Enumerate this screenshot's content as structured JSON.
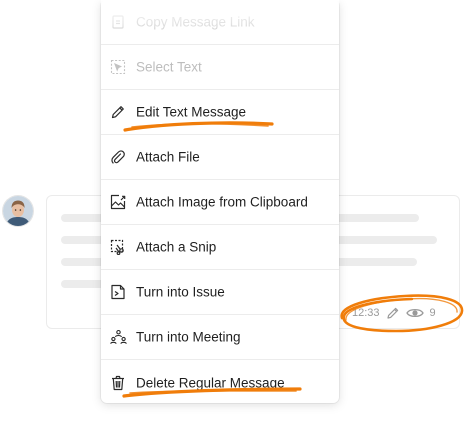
{
  "menu": {
    "items": [
      {
        "label": "Copy Message Link",
        "icon": "link-copy-icon",
        "disabled": true
      },
      {
        "label": "Select Text",
        "icon": "select-text-icon",
        "disabled": true
      },
      {
        "label": "Edit Text Message",
        "icon": "pencil-icon",
        "disabled": false
      },
      {
        "label": "Attach File",
        "icon": "paperclip-icon",
        "disabled": false
      },
      {
        "label": "Attach Image from Clipboard",
        "icon": "image-clipboard-icon",
        "disabled": false
      },
      {
        "label": "Attach a Snip",
        "icon": "snip-icon",
        "disabled": false
      },
      {
        "label": "Turn into Issue",
        "icon": "issue-icon",
        "disabled": false
      },
      {
        "label": "Turn into Meeting",
        "icon": "meeting-icon",
        "disabled": false
      },
      {
        "label": "Delete Regular Message",
        "icon": "trash-icon",
        "disabled": false
      }
    ]
  },
  "message": {
    "time": "12:33",
    "views": "9"
  },
  "colors": {
    "highlight": "#f07d0a",
    "text": "#1f1f1f",
    "disabled_text": "#bdbdbd",
    "meta_text": "#9a9a9a",
    "skeleton": "#ececec"
  }
}
